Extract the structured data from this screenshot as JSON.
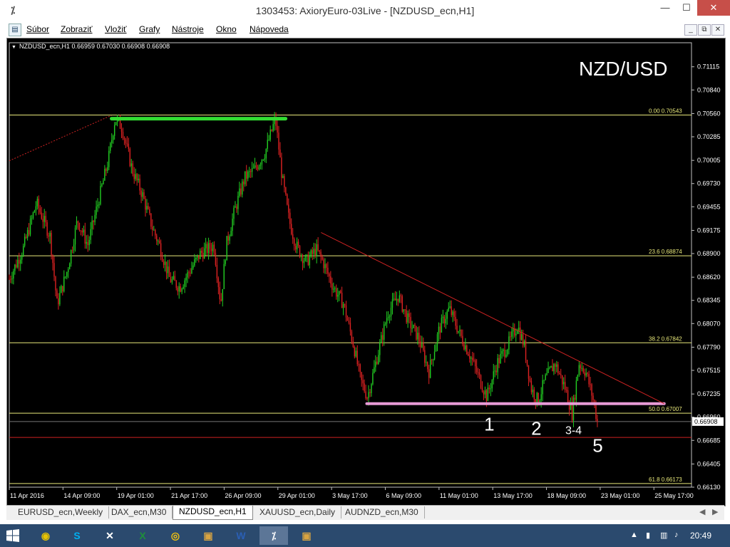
{
  "window": {
    "app_icon": "metatrader-icon",
    "title": "1303453: AxioryEuro-03Live - [NZDUSD_ecn,H1]",
    "buttons": [
      "minimize-icon",
      "maximize-icon",
      "close-icon"
    ]
  },
  "menu": {
    "items": [
      "Súbor",
      "Zobraziť",
      "Vložiť",
      "Grafy",
      "Nástroje",
      "Okno",
      "Nápoveda"
    ],
    "mdi_buttons": [
      "_",
      "⧉",
      "✕"
    ]
  },
  "chart_data": {
    "type": "candlestick",
    "symbol_header": "NZDUSD_ecn,H1  0.66959 0.67030 0.66908 0.66908",
    "overlay_title": "NZD/USD",
    "ylim": [
      0.6613,
      0.714
    ],
    "y_ticks": [
      "0.71115",
      "0.70840",
      "0.70560",
      "0.70285",
      "0.70005",
      "0.69730",
      "0.69455",
      "0.69175",
      "0.68900",
      "0.68620",
      "0.68345",
      "0.68070",
      "0.67790",
      "0.67515",
      "0.67235",
      "0.66960",
      "0.66685",
      "0.66405",
      "0.66130"
    ],
    "x_ticks": [
      "11 Apr 2016",
      "14 Apr 09:00",
      "19 Apr 01:00",
      "21 Apr 17:00",
      "26 Apr 09:00",
      "29 Apr 01:00",
      "3 May 17:00",
      "6 May 09:00",
      "11 May 01:00",
      "13 May 17:00",
      "18 May 09:00",
      "23 May 01:00",
      "25 May 17:00"
    ],
    "current_price": "0.66908",
    "fib_levels": [
      {
        "label": "0.00  0.70543",
        "value": 0.70543
      },
      {
        "label": "23.6  0.68874",
        "value": 0.68874
      },
      {
        "label": "38.2  0.67842",
        "value": 0.67842
      },
      {
        "label": "50.0  0.67007",
        "value": 0.67007
      },
      {
        "label": "61.8  0.66173",
        "value": 0.66173
      }
    ],
    "horizontal_red_line": 0.6672,
    "green_resistance": {
      "from_index": 0.15,
      "to_index": 0.405,
      "price": 0.705
    },
    "pink_support": {
      "from_index": 0.524,
      "to_index": 0.96,
      "price": 0.6712
    },
    "trendline": {
      "from": [
        0.457,
        0.6915
      ],
      "to": [
        0.96,
        0.6712
      ]
    },
    "wave_labels": [
      {
        "text": "1",
        "x": 0.696,
        "price": 0.668
      },
      {
        "text": "2",
        "x": 0.765,
        "price": 0.6675
      },
      {
        "text": "3-4",
        "x": 0.815,
        "price": 0.6676
      },
      {
        "text": "5",
        "x": 0.855,
        "price": 0.6655
      }
    ],
    "price_path": [
      [
        0.0,
        0.686
      ],
      [
        0.02,
        0.6895
      ],
      [
        0.04,
        0.695
      ],
      [
        0.06,
        0.691
      ],
      [
        0.07,
        0.683
      ],
      [
        0.085,
        0.687
      ],
      [
        0.1,
        0.693
      ],
      [
        0.115,
        0.69
      ],
      [
        0.13,
        0.695
      ],
      [
        0.145,
        0.7
      ],
      [
        0.155,
        0.705
      ],
      [
        0.165,
        0.704
      ],
      [
        0.18,
        0.699
      ],
      [
        0.195,
        0.696
      ],
      [
        0.21,
        0.692
      ],
      [
        0.22,
        0.69
      ],
      [
        0.235,
        0.686
      ],
      [
        0.25,
        0.685
      ],
      [
        0.265,
        0.687
      ],
      [
        0.28,
        0.689
      ],
      [
        0.3,
        0.69
      ],
      [
        0.31,
        0.683
      ],
      [
        0.318,
        0.69
      ],
      [
        0.33,
        0.694
      ],
      [
        0.345,
        0.698
      ],
      [
        0.36,
        0.699
      ],
      [
        0.375,
        0.701
      ],
      [
        0.39,
        0.705
      ],
      [
        0.4,
        0.698
      ],
      [
        0.41,
        0.693
      ],
      [
        0.42,
        0.69
      ],
      [
        0.435,
        0.688
      ],
      [
        0.45,
        0.6895
      ],
      [
        0.46,
        0.688
      ],
      [
        0.475,
        0.685
      ],
      [
        0.49,
        0.683
      ],
      [
        0.505,
        0.678
      ],
      [
        0.515,
        0.674
      ],
      [
        0.525,
        0.672
      ],
      [
        0.54,
        0.677
      ],
      [
        0.555,
        0.682
      ],
      [
        0.57,
        0.684
      ],
      [
        0.585,
        0.681
      ],
      [
        0.6,
        0.679
      ],
      [
        0.615,
        0.675
      ],
      [
        0.63,
        0.68
      ],
      [
        0.645,
        0.6825
      ],
      [
        0.66,
        0.6795
      ],
      [
        0.675,
        0.677
      ],
      [
        0.69,
        0.674
      ],
      [
        0.7,
        0.672
      ],
      [
        0.715,
        0.676
      ],
      [
        0.73,
        0.678
      ],
      [
        0.745,
        0.6805
      ],
      [
        0.755,
        0.678
      ],
      [
        0.765,
        0.673
      ],
      [
        0.775,
        0.6715
      ],
      [
        0.785,
        0.674
      ],
      [
        0.8,
        0.676
      ],
      [
        0.815,
        0.673
      ],
      [
        0.825,
        0.67
      ],
      [
        0.835,
        0.676
      ],
      [
        0.845,
        0.675
      ],
      [
        0.855,
        0.672
      ],
      [
        0.862,
        0.6691
      ]
    ]
  },
  "tabs": {
    "items": [
      "EURUSD_ecn,Weekly",
      "DAX_ecn,M30",
      "NZDUSD_ecn,H1",
      "XAUUSD_ecn,Daily",
      "AUDNZD_ecn,M30"
    ],
    "active_index": 2
  },
  "taskbar": {
    "apps": [
      "windows-start-icon",
      "metatrader-icon",
      "skype-icon",
      "unknown-app-icon",
      "excel-icon",
      "chrome-icon",
      "photo-icon",
      "word-icon",
      "metatrader-icon",
      "photo-icon"
    ],
    "time": "20:49"
  },
  "colors": {
    "chart_bg": "#000000",
    "bull_candle": "#22cc22",
    "bear_candle": "#dd2222",
    "fib_line": "#e8e87a",
    "resistance": "#33dd33",
    "support": "#e89ad6",
    "trendline": "#cc2222",
    "axis_text": "#ffffff"
  }
}
